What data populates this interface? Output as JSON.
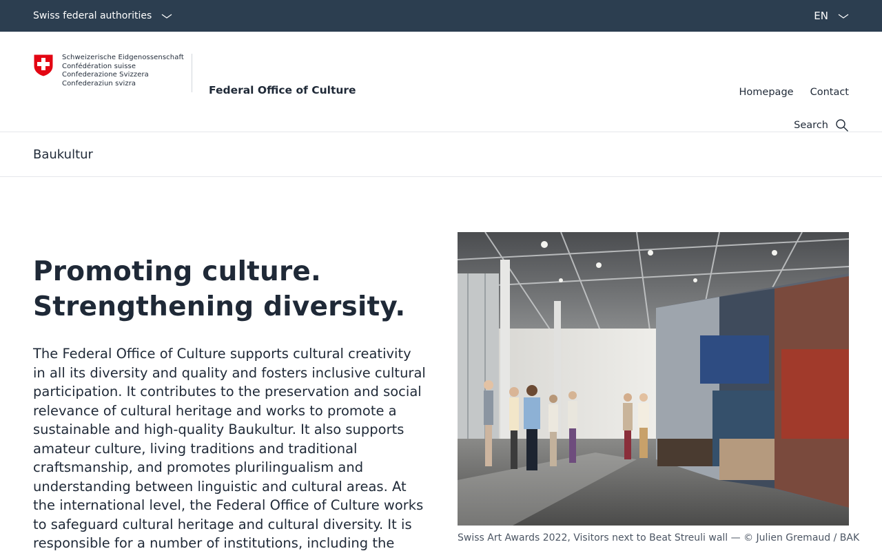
{
  "topbar": {
    "authorities_label": "Swiss federal authorities",
    "language": "EN"
  },
  "header": {
    "confederation_lines": [
      "Schweizerische Eidgenossenschaft",
      "Confédération suisse",
      "Confederazione Svizzera",
      "Confederaziun svizra"
    ],
    "office_name": "Federal Office of Culture",
    "links": {
      "homepage": "Homepage",
      "contact": "Contact"
    },
    "search_label": "Search"
  },
  "section": {
    "title": "Baukultur"
  },
  "main": {
    "headline_line1": "Promoting culture.",
    "headline_line2": "Strengthening diversity.",
    "lead": "The Federal Office of Culture supports cultural creativity in all its diversity and quality and fosters inclusive cultural participation. It contributes to the preservation and social relevance of cultural heritage and works to promote a sustainable and high-quality Baukultur. It also supports amateur culture, living traditions and traditional craftsmanship, and promotes plurilingualism and understanding between linguistic and cultural areas. At the international level, the Federal Office of Culture works to safeguard cultural heritage and cultural diversity. It is responsible for a number of institutions, including the",
    "image_caption": "Swiss Art Awards 2022, Visitors next to Beat Streuli wall — © Julien Gremaud / BAK"
  },
  "colors": {
    "topbar_bg": "#2c3e50",
    "text": "#1f2937",
    "swiss_red": "#e30613"
  },
  "icons": {
    "authorities_toggle": "chevron-down-icon",
    "language_toggle": "chevron-down-icon",
    "search": "search-icon",
    "crest": "swiss-cross-icon"
  }
}
